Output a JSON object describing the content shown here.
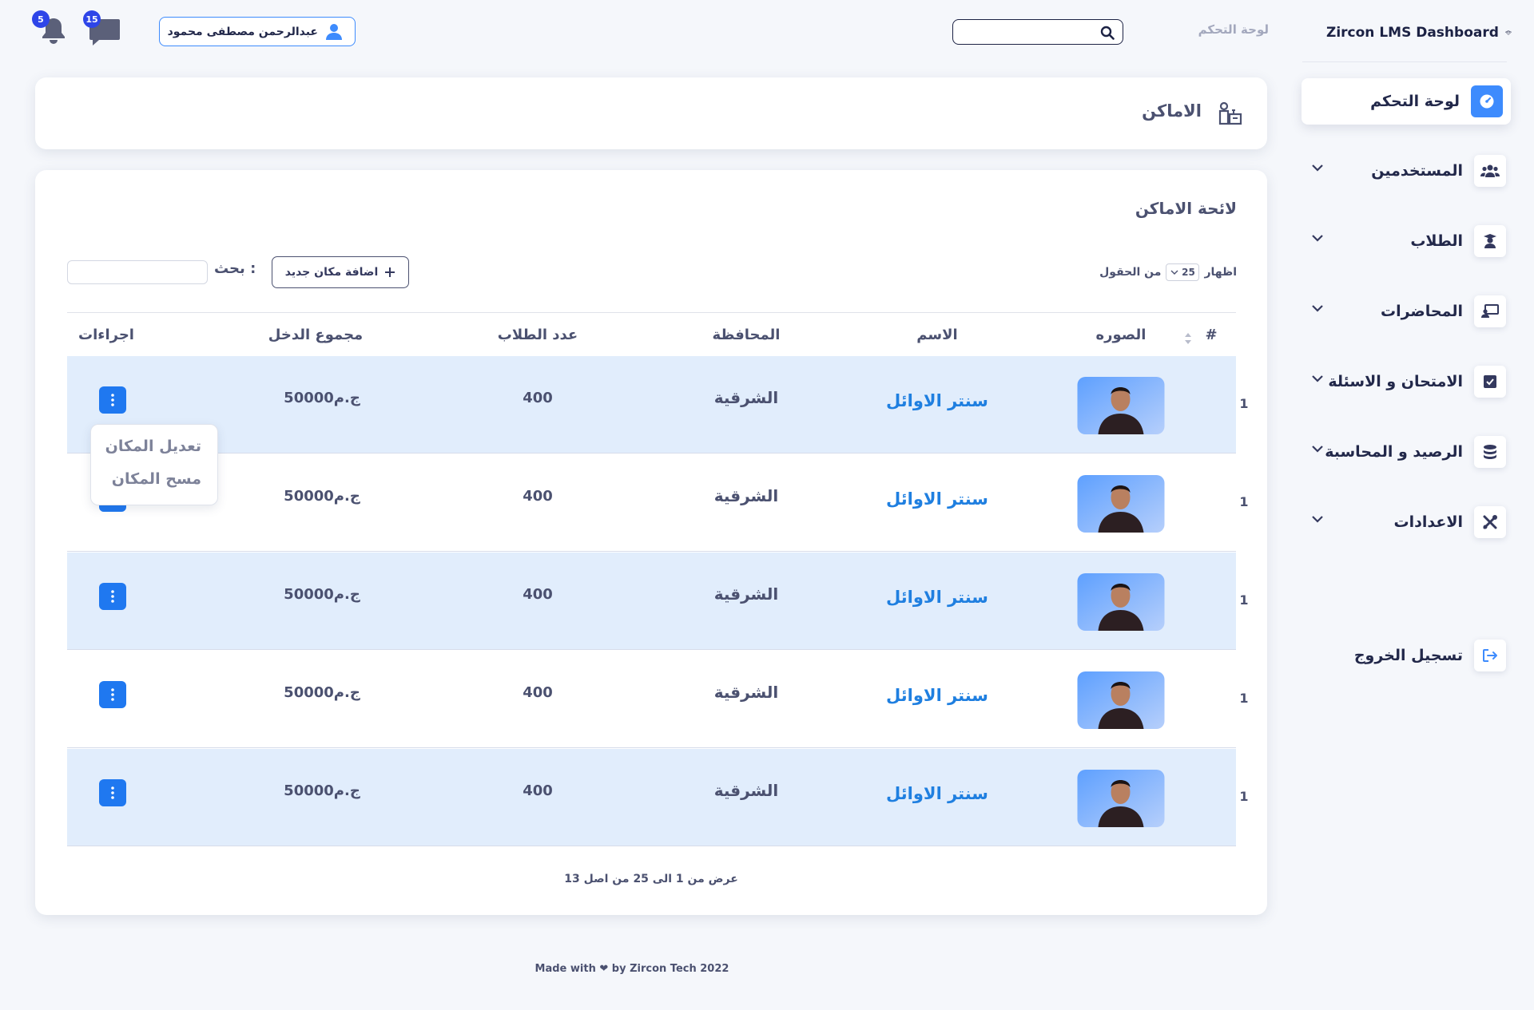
{
  "brand": {
    "name": "Zircon LMS Dashboard"
  },
  "header": {
    "breadcrumb": "لوحة التحكم",
    "search_placeholder": "",
    "user_name": "عبدالرحمن مصطفى محمود",
    "notifications_count": "5",
    "messages_count": "15"
  },
  "sidebar": {
    "items": [
      {
        "label": "لوحة التحكم",
        "icon": "dashboard-icon",
        "active": true
      },
      {
        "label": "المستخدمين",
        "icon": "users-icon"
      },
      {
        "label": "الطلاب",
        "icon": "student-icon"
      },
      {
        "label": "المحاضرات",
        "icon": "lecture-icon"
      },
      {
        "label": "الامتحان و الاسئلة",
        "icon": "exam-icon"
      },
      {
        "label": "الرصيد و المحاسبة",
        "icon": "coins-icon"
      },
      {
        "label": "الاعدادات",
        "icon": "settings-tools-icon"
      }
    ],
    "logout_label": "تسجيل الخروج"
  },
  "page": {
    "title": "الاماكن",
    "list_title": "لائحة الاماكن",
    "show_label": "اظهار",
    "entries_value": "25",
    "entries_suffix": "من الحقول",
    "add_button": "اضافة مكان جديد",
    "search_label": "بحث :",
    "search_value": "",
    "showing_text": "عرض من 1 الى 25 من اصل 13"
  },
  "table": {
    "columns": {
      "num": "#",
      "photo": "الصوره",
      "name": "الاسم",
      "governorate": "المحافظة",
      "students": "عدد الطلاب",
      "income": "مجموع الدخل",
      "actions": "اجراءات"
    },
    "rows": [
      {
        "num": "1",
        "name": "سنتر الاوائل",
        "governorate": "الشرقية",
        "students": "400",
        "income": "50000ج.م"
      },
      {
        "num": "1",
        "name": "سنتر الاوائل",
        "governorate": "الشرقية",
        "students": "400",
        "income": "50000ج.م"
      },
      {
        "num": "1",
        "name": "سنتر الاوائل",
        "governorate": "الشرقية",
        "students": "400",
        "income": "50000ج.م"
      },
      {
        "num": "1",
        "name": "سنتر الاوائل",
        "governorate": "الشرقية",
        "students": "400",
        "income": "50000ج.م"
      },
      {
        "num": "1",
        "name": "سنتر الاوائل",
        "governorate": "الشرقية",
        "students": "400",
        "income": "50000ج.م"
      }
    ]
  },
  "dropdown": {
    "edit": "تعديل المكان",
    "delete": "مسح المكان"
  },
  "footer": {
    "text": "Made with ❤ by Zircon Tech 2022"
  },
  "colors": {
    "accent": "#1f78f0",
    "row_shade": "#e1edfc",
    "badge": "#2e45e8",
    "text": "#34395e"
  }
}
